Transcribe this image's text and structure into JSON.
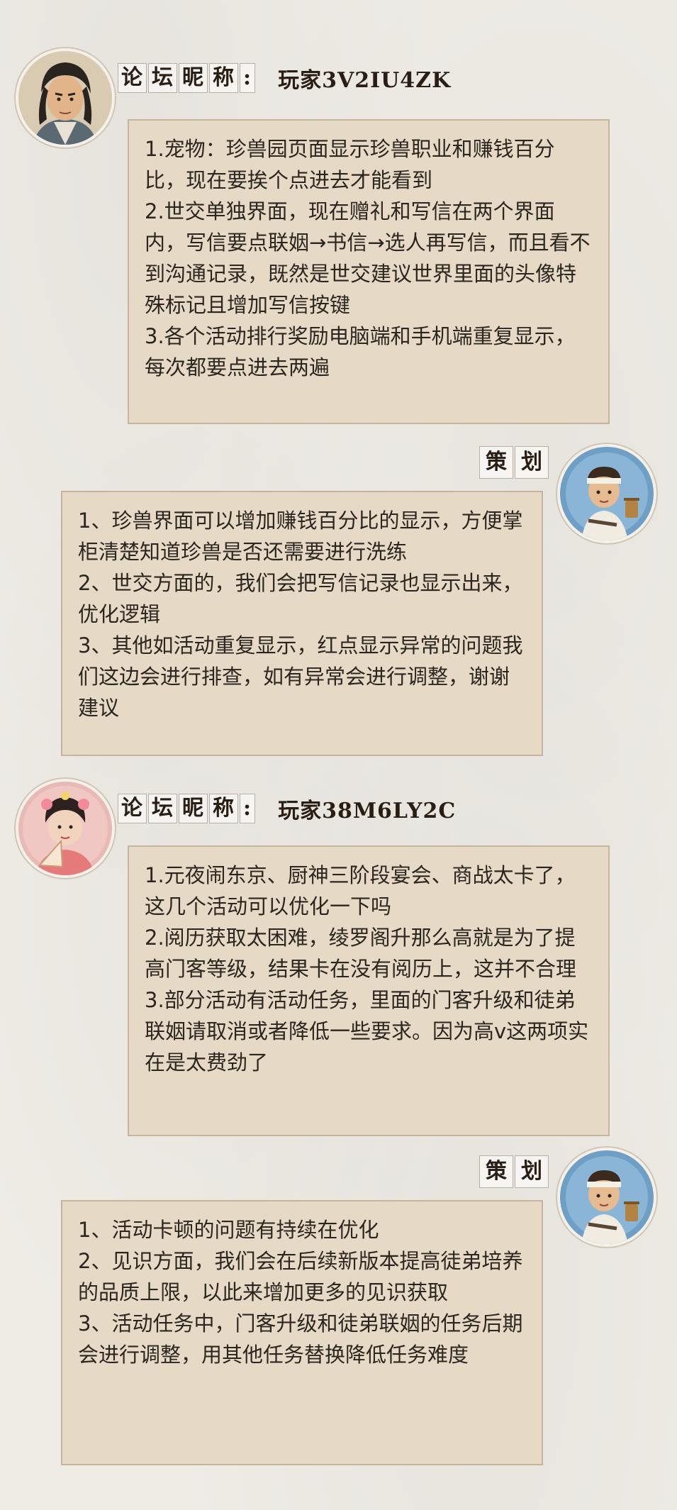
{
  "conversations": [
    {
      "nickname_label": "论坛昵称:",
      "player_name": "玩家3V2IU4ZK",
      "avatar": "scholar-man-avatar",
      "lines": [
        "1.宠物：珍兽园页面显示珍兽职业和赚钱百分比，现在要挨个点进去才能看到",
        "2.世交单独界面，现在赠礼和写信在两个界面内，写信要点联姻→书信→选人再写信，而且看不到沟通记录，既然是世交建议世界里面的头像特殊标记且增加写信按键",
        "3.各个活动排行奖励电脑端和手机端重复显示，每次都要点进去两遍"
      ]
    },
    {
      "tag_label": "策划",
      "avatar": "porter-man-avatar",
      "lines": [
        "1、珍兽界面可以增加赚钱百分比的显示，方便掌柜清楚知道珍兽是否还需要进行洗练",
        "2、世交方面的，我们会把写信记录也显示出来，优化逻辑",
        "3、其他如活动重复显示，红点显示异常的问题我们这边会进行排查，如有异常会进行调整，谢谢建议"
      ]
    },
    {
      "nickname_label": "论坛昵称:",
      "player_name": "玩家38M6LY2C",
      "avatar": "lady-with-fan-avatar",
      "lines": [
        "1.元夜闹东京、厨神三阶段宴会、商战太卡了，这几个活动可以优化一下吗",
        "2.阅历获取太困难，绫罗阁升那么高就是为了提高门客等级，结果卡在没有阅历上，这并不合理",
        "3.部分活动有活动任务，里面的门客升级和徒弟联姻请取消或者降低一些要求。因为高v这两项实在是太费劲了"
      ]
    },
    {
      "tag_label": "策划",
      "avatar": "porter-man-avatar",
      "lines": [
        "1、活动卡顿的问题有持续在优化",
        "2、见识方面，我们会在后续新版本提高徒弟培养的品质上限，以此来增加更多的见识获取",
        "3、活动任务中，门客升级和徒弟联姻的任务后期会进行调整，用其他任务替换降低任务难度"
      ]
    }
  ]
}
